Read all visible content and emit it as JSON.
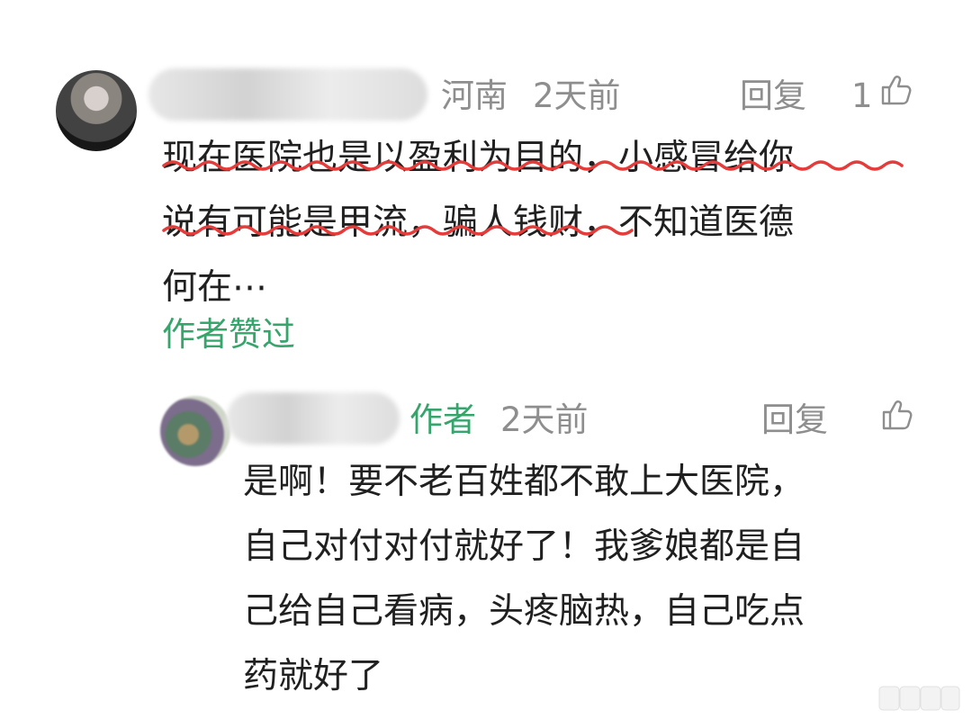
{
  "comment": {
    "location": "河南",
    "time": "2天前",
    "reply_label": "回复",
    "like_count": "1",
    "lines": [
      "现在医院也是以盈利为目的，小感冒给你",
      "说有可能是甲流，骗人钱财，不知道医德",
      "何在⋯"
    ],
    "author_liked": "作者赞过"
  },
  "reply": {
    "author_tag": "作者",
    "time": "2天前",
    "reply_label": "回复",
    "lines": [
      "是啊！要不老百姓都不敢上大医院，",
      "自己对付对付就好了！我爹娘都是自",
      "己给自己看病，头疼脑热，自己吃点",
      "药就好了"
    ]
  },
  "colors": {
    "text": "#202020",
    "meta": "#8e8e8e",
    "author_green": "#35a56b",
    "underline_red": "#e53b3b"
  },
  "icons": [
    "thumb-up-icon",
    "watermark-icon"
  ]
}
